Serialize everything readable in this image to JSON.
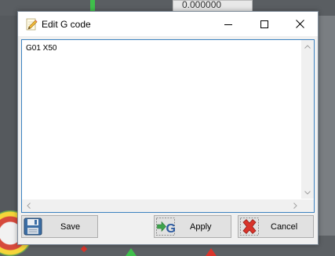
{
  "background_app": {
    "field_value": "0.000000"
  },
  "dialog": {
    "title": "Edit G code",
    "editor_text": "G01 X50",
    "buttons": {
      "save": "Save",
      "apply": "Apply",
      "cancel": "Cancel"
    }
  },
  "colors": {
    "editor_border": "#3c82c0",
    "cancel_x": "#d9342b",
    "apply_arrow": "#3fa34d"
  },
  "icons": {
    "title": "pencil-icon",
    "save": "floppy-disk-icon",
    "apply": "arrow-g-icon",
    "cancel": "red-x-icon"
  }
}
